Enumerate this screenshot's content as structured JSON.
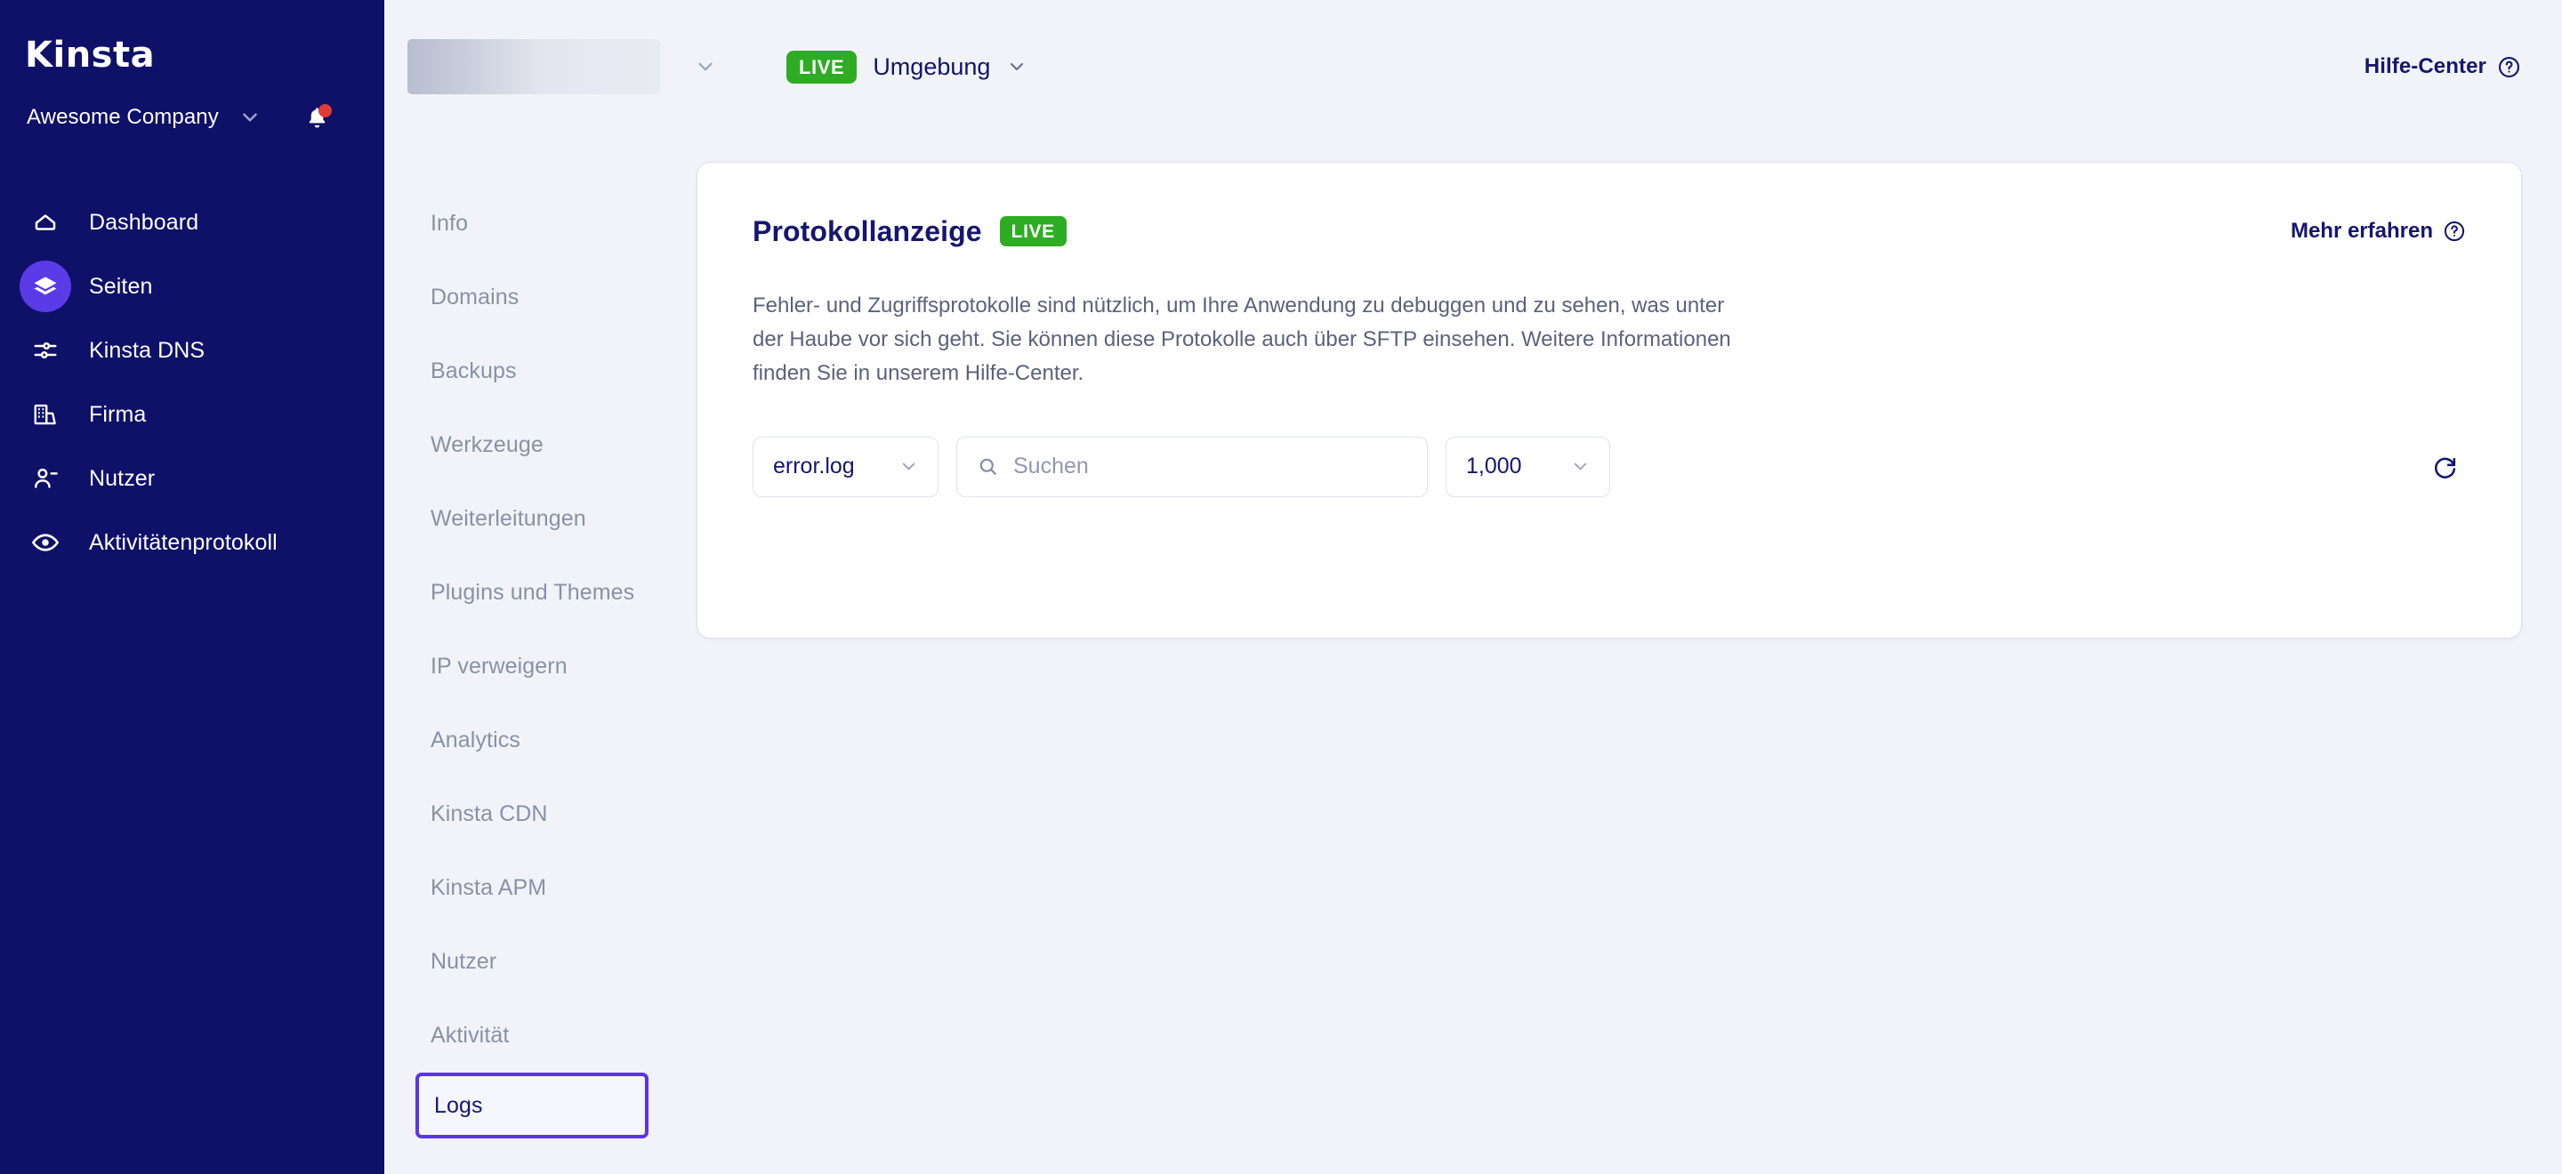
{
  "sidebar": {
    "logo_text": "Kinsta",
    "org_name": "Awesome Company",
    "items": [
      {
        "label": "Dashboard",
        "icon": "home-icon"
      },
      {
        "label": "Seiten",
        "icon": "layers-icon"
      },
      {
        "label": "Kinsta DNS",
        "icon": "dns-icon"
      },
      {
        "label": "Firma",
        "icon": "building-icon"
      },
      {
        "label": "Nutzer",
        "icon": "user-icon"
      },
      {
        "label": "Aktivitätenprotokoll",
        "icon": "eye-icon"
      }
    ],
    "active_index": 1,
    "bg_color": "#0F1068",
    "active_badge_color": "#5A3BE8",
    "notification_dot_color": "#E03B35"
  },
  "topbar": {
    "site_skeleton_placeholder": "",
    "environment_badge": "LIVE",
    "environment_label": "Umgebung",
    "help_center_label": "Hilfe-Center",
    "live_color": "#2EAC24"
  },
  "subnav": {
    "items": [
      {
        "label": "Info"
      },
      {
        "label": "Domains"
      },
      {
        "label": "Backups"
      },
      {
        "label": "Werkzeuge"
      },
      {
        "label": "Weiterleitungen"
      },
      {
        "label": "Plugins und Themes"
      },
      {
        "label": "IP verweigern"
      },
      {
        "label": "Analytics"
      },
      {
        "label": "Kinsta CDN"
      },
      {
        "label": "Kinsta APM"
      },
      {
        "label": "Nutzer"
      },
      {
        "label": "Aktivität"
      },
      {
        "label": "Logs"
      }
    ],
    "selected_index": 12,
    "selected_outline_color": "#5A34E8"
  },
  "card": {
    "title": "Protokollanzeige",
    "live_badge": "LIVE",
    "learn_more_label": "Mehr erfahren",
    "description": "Fehler- und Zugriffsprotokolle sind nützlich, um Ihre Anwendung zu debuggen und zu sehen, was unter der Haube vor sich geht. Sie können diese Protokolle auch über SFTP einsehen. Weitere Informationen finden Sie in unserem Hilfe-Center.",
    "controls": {
      "log_file_value": "error.log",
      "search_value": "",
      "search_placeholder": "Suchen",
      "line_limit_value": "1,000",
      "refresh_icon": "refresh-icon"
    }
  }
}
